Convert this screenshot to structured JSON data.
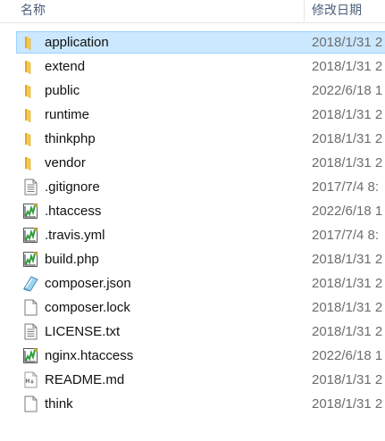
{
  "columns": {
    "name": "名称",
    "date": "修改日期"
  },
  "colors": {
    "folder": "#f5c94c",
    "selected_bg": "#cce8ff",
    "selected_border": "#99d1ff"
  },
  "files": [
    {
      "name": "application",
      "date": "2018/1/31 2",
      "icon": "folder-icon",
      "selected": true
    },
    {
      "name": "extend",
      "date": "2018/1/31 2",
      "icon": "folder-icon"
    },
    {
      "name": "public",
      "date": "2022/6/18 1",
      "icon": "folder-icon"
    },
    {
      "name": "runtime",
      "date": "2018/1/31 2",
      "icon": "folder-icon"
    },
    {
      "name": "thinkphp",
      "date": "2018/1/31 2",
      "icon": "folder-icon"
    },
    {
      "name": "vendor",
      "date": "2018/1/31 2",
      "icon": "folder-icon"
    },
    {
      "name": ".gitignore",
      "date": "2017/7/4 8:",
      "icon": "text-file-icon"
    },
    {
      "name": ".htaccess",
      "date": "2022/6/18 1",
      "icon": "notepadpp-file-icon"
    },
    {
      "name": ".travis.yml",
      "date": "2017/7/4 8:",
      "icon": "notepadpp-file-icon"
    },
    {
      "name": "build.php",
      "date": "2018/1/31 2",
      "icon": "notepadpp-file-icon"
    },
    {
      "name": "composer.json",
      "date": "2018/1/31 2",
      "icon": "json-file-icon"
    },
    {
      "name": "composer.lock",
      "date": "2018/1/31 2",
      "icon": "blank-file-icon"
    },
    {
      "name": "LICENSE.txt",
      "date": "2018/1/31 2",
      "icon": "text-file-icon"
    },
    {
      "name": "nginx.htaccess",
      "date": "2022/6/18 1",
      "icon": "notepadpp-file-icon"
    },
    {
      "name": "README.md",
      "date": "2018/1/31 2",
      "icon": "markdown-file-icon"
    },
    {
      "name": "think",
      "date": "2018/1/31 2",
      "icon": "blank-file-icon"
    }
  ]
}
